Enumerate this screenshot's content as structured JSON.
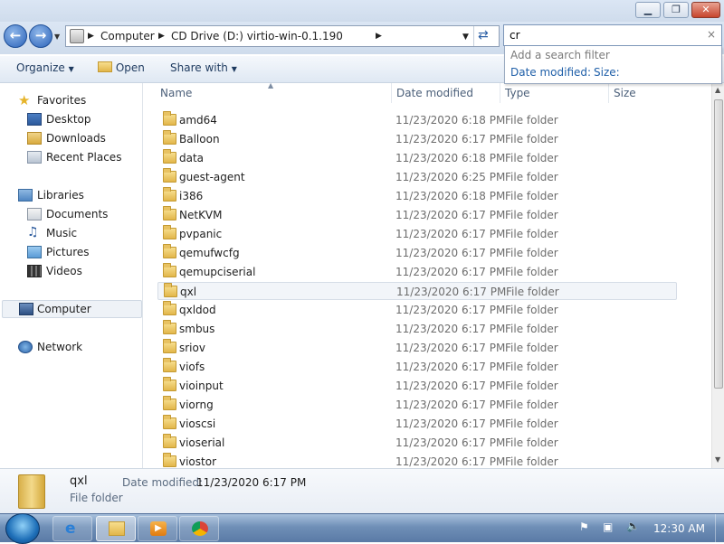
{
  "window": {
    "minimize_glyph": "▁",
    "maximize_glyph": "❐",
    "close_glyph": "✕"
  },
  "nav": {
    "back_glyph": "←",
    "forward_glyph": "→",
    "breadcrumb": [
      "Computer",
      "CD Drive (D:) virtio-win-0.1.190"
    ]
  },
  "search": {
    "value": "cr",
    "clear_glyph": "×",
    "filter_hint": "Add a search filter",
    "filters": [
      "Date modified:",
      "Size:"
    ]
  },
  "toolbar": {
    "organize": "Organize",
    "open": "Open",
    "share_with": "Share with"
  },
  "sidebar": {
    "favorites": "Favorites",
    "desktop": "Desktop",
    "downloads": "Downloads",
    "recent_places": "Recent Places",
    "libraries": "Libraries",
    "documents": "Documents",
    "music": "Music",
    "pictures": "Pictures",
    "videos": "Videos",
    "computer": "Computer",
    "network": "Network"
  },
  "columns": {
    "name": "Name",
    "date_modified": "Date modified",
    "type": "Type",
    "size": "Size"
  },
  "files": [
    {
      "name": "amd64",
      "date": "11/23/2020 6:18 PM",
      "type": "File folder"
    },
    {
      "name": "Balloon",
      "date": "11/23/2020 6:17 PM",
      "type": "File folder"
    },
    {
      "name": "data",
      "date": "11/23/2020 6:18 PM",
      "type": "File folder"
    },
    {
      "name": "guest-agent",
      "date": "11/23/2020 6:25 PM",
      "type": "File folder"
    },
    {
      "name": "i386",
      "date": "11/23/2020 6:18 PM",
      "type": "File folder"
    },
    {
      "name": "NetKVM",
      "date": "11/23/2020 6:17 PM",
      "type": "File folder"
    },
    {
      "name": "pvpanic",
      "date": "11/23/2020 6:17 PM",
      "type": "File folder"
    },
    {
      "name": "qemufwcfg",
      "date": "11/23/2020 6:17 PM",
      "type": "File folder"
    },
    {
      "name": "qemupciserial",
      "date": "11/23/2020 6:17 PM",
      "type": "File folder"
    },
    {
      "name": "qxl",
      "date": "11/23/2020 6:17 PM",
      "type": "File folder"
    },
    {
      "name": "qxldod",
      "date": "11/23/2020 6:17 PM",
      "type": "File folder"
    },
    {
      "name": "smbus",
      "date": "11/23/2020 6:17 PM",
      "type": "File folder"
    },
    {
      "name": "sriov",
      "date": "11/23/2020 6:17 PM",
      "type": "File folder"
    },
    {
      "name": "viofs",
      "date": "11/23/2020 6:17 PM",
      "type": "File folder"
    },
    {
      "name": "vioinput",
      "date": "11/23/2020 6:17 PM",
      "type": "File folder"
    },
    {
      "name": "viorng",
      "date": "11/23/2020 6:17 PM",
      "type": "File folder"
    },
    {
      "name": "vioscsi",
      "date": "11/23/2020 6:17 PM",
      "type": "File folder"
    },
    {
      "name": "vioserial",
      "date": "11/23/2020 6:17 PM",
      "type": "File folder"
    },
    {
      "name": "viostor",
      "date": "11/23/2020 6:17 PM",
      "type": "File folder"
    }
  ],
  "details": {
    "name": "qxl",
    "date_label": "Date modified:",
    "date_value": "11/23/2020 6:17 PM",
    "type": "File folder"
  },
  "taskbar": {
    "clock": "12:30 AM"
  },
  "colors": {
    "accent": "#1e3a5f",
    "link": "#1f5fa8"
  }
}
